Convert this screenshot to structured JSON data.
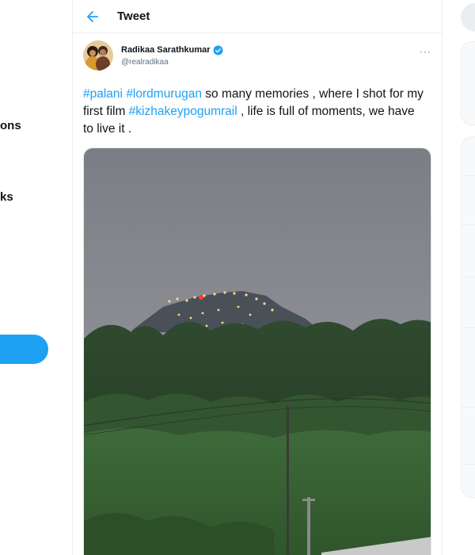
{
  "left_nav": {
    "items": [
      {
        "label": "ons"
      },
      {
        "label": "ks"
      }
    ]
  },
  "header": {
    "title": "Tweet"
  },
  "tweet": {
    "author": {
      "display_name": "Radikaa Sarathkumar",
      "handle": "@realradikaa",
      "verified": true
    },
    "text_parts": [
      {
        "type": "hashtag",
        "text": "#palani"
      },
      {
        "type": "text",
        "text": " "
      },
      {
        "type": "hashtag",
        "text": "#lordmurugan"
      },
      {
        "type": "text",
        "text": " so many memories , where I shot for my first film "
      },
      {
        "type": "hashtag",
        "text": "#kizhakeypogumrail"
      },
      {
        "type": "text",
        "text": " , life is full of moments, we have to live it ."
      }
    ],
    "more_label": "···"
  },
  "colors": {
    "accent": "#1da1f2",
    "text": "#0f1419",
    "secondary": "#5b7083",
    "border": "#ebeef0"
  }
}
